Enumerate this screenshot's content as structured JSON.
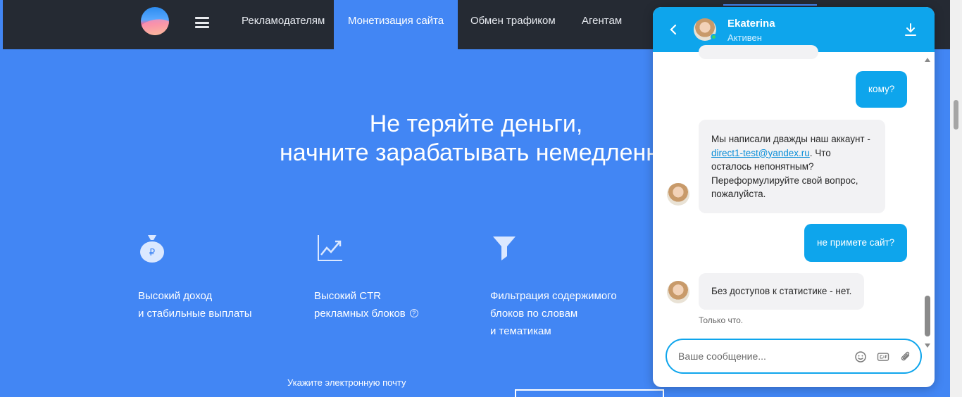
{
  "nav": {
    "items": [
      {
        "label": "Рекламодателям",
        "active": false
      },
      {
        "label": "Монетизация сайта",
        "active": true
      },
      {
        "label": "Обмен трафиком",
        "active": false
      },
      {
        "label": "Агентам",
        "active": false
      }
    ]
  },
  "hero": {
    "line1": "Не теряйте деньги,",
    "line2": "начните зарабатывать немедленно"
  },
  "features": [
    {
      "icon": "money-bag-icon",
      "line1": "Высокий доход",
      "line2": "и стабильные выплаты",
      "line3": ""
    },
    {
      "icon": "chart-growth-icon",
      "line1": "Высокий CTR",
      "line2": "рекламных блоков",
      "line3": ""
    },
    {
      "icon": "filter-icon",
      "line1": "Фильтрация содержимого",
      "line2": "блоков по словам",
      "line3": "и тематикам"
    }
  ],
  "email_prompt": "Укажите электронную почту",
  "chat": {
    "agent_name": "Ekaterina",
    "agent_status": "Активен",
    "messages": [
      {
        "from": "user",
        "text": "кому?"
      },
      {
        "from": "agent",
        "text_before": "Мы написали дважды наш аккаунт - ",
        "link": "direct1-test@yandex.ru",
        "text_after": ". Что осталось непонятным? Переформулируйте свой вопрос, пожалуйста."
      },
      {
        "from": "user",
        "text": "не примете сайт?"
      },
      {
        "from": "agent",
        "text": "Без доступов к статистике - нет."
      }
    ],
    "timestamp": "Только что.",
    "composer_placeholder": "Ваше сообщение..."
  },
  "colors": {
    "page_bg": "#4286f4",
    "topbar_bg": "#252a33",
    "chat_accent": "#0ea5ec",
    "bubble_in": "#f2f2f4"
  }
}
